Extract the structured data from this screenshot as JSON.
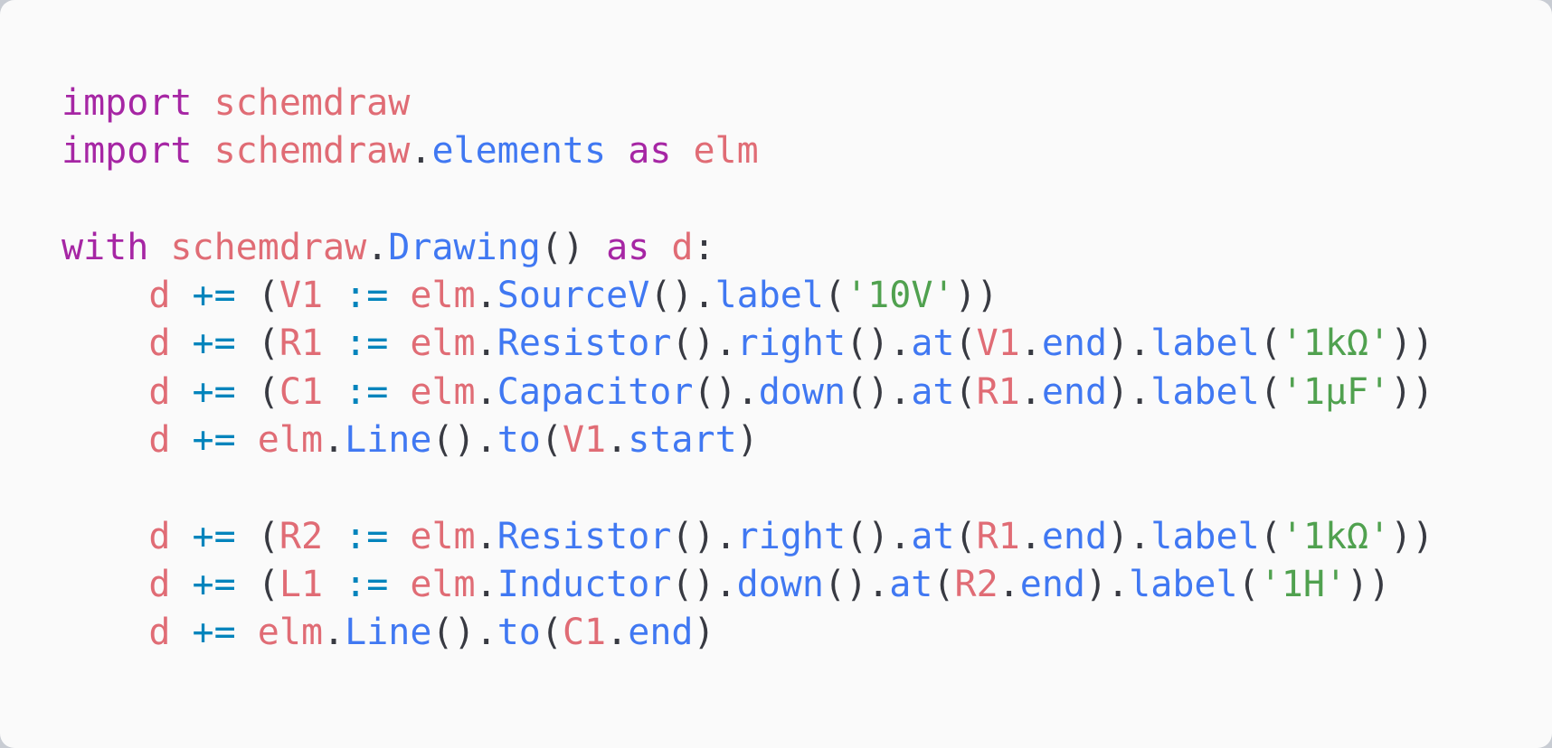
{
  "theme": {
    "background": "#fafafa",
    "text": "#383a42",
    "keyword": "#a626a4",
    "variable": "#e06c75",
    "function": "#4078f2",
    "operator": "#0184bc",
    "string": "#50a14f"
  },
  "code": {
    "language": "python",
    "lines": [
      [
        [
          "kw",
          "import"
        ],
        [
          "pn",
          " "
        ],
        [
          "var",
          "schemdraw"
        ]
      ],
      [
        [
          "kw",
          "import"
        ],
        [
          "pn",
          " "
        ],
        [
          "var",
          "schemdraw"
        ],
        [
          "pn",
          "."
        ],
        [
          "fn",
          "elements"
        ],
        [
          "pn",
          " "
        ],
        [
          "kw",
          "as"
        ],
        [
          "pn",
          " "
        ],
        [
          "var",
          "elm"
        ]
      ],
      [],
      [
        [
          "kw",
          "with"
        ],
        [
          "pn",
          " "
        ],
        [
          "var",
          "schemdraw"
        ],
        [
          "pn",
          "."
        ],
        [
          "fn",
          "Drawing"
        ],
        [
          "pn",
          "() "
        ],
        [
          "kw",
          "as"
        ],
        [
          "pn",
          " "
        ],
        [
          "var",
          "d"
        ],
        [
          "pn",
          ":"
        ]
      ],
      [
        [
          "pn",
          "    "
        ],
        [
          "var",
          "d"
        ],
        [
          "pn",
          " "
        ],
        [
          "op",
          "+="
        ],
        [
          "pn",
          " ("
        ],
        [
          "var",
          "V1"
        ],
        [
          "pn",
          " "
        ],
        [
          "op",
          ":="
        ],
        [
          "pn",
          " "
        ],
        [
          "var",
          "elm"
        ],
        [
          "pn",
          "."
        ],
        [
          "fn",
          "SourceV"
        ],
        [
          "pn",
          "()."
        ],
        [
          "fn",
          "label"
        ],
        [
          "pn",
          "("
        ],
        [
          "str",
          "'10V'"
        ],
        [
          "pn",
          "))"
        ]
      ],
      [
        [
          "pn",
          "    "
        ],
        [
          "var",
          "d"
        ],
        [
          "pn",
          " "
        ],
        [
          "op",
          "+="
        ],
        [
          "pn",
          " ("
        ],
        [
          "var",
          "R1"
        ],
        [
          "pn",
          " "
        ],
        [
          "op",
          ":="
        ],
        [
          "pn",
          " "
        ],
        [
          "var",
          "elm"
        ],
        [
          "pn",
          "."
        ],
        [
          "fn",
          "Resistor"
        ],
        [
          "pn",
          "()."
        ],
        [
          "fn",
          "right"
        ],
        [
          "pn",
          "()."
        ],
        [
          "fn",
          "at"
        ],
        [
          "pn",
          "("
        ],
        [
          "var",
          "V1"
        ],
        [
          "pn",
          "."
        ],
        [
          "fn",
          "end"
        ],
        [
          "pn",
          ")."
        ],
        [
          "fn",
          "label"
        ],
        [
          "pn",
          "("
        ],
        [
          "str",
          "'1kΩ'"
        ],
        [
          "pn",
          "))"
        ]
      ],
      [
        [
          "pn",
          "    "
        ],
        [
          "var",
          "d"
        ],
        [
          "pn",
          " "
        ],
        [
          "op",
          "+="
        ],
        [
          "pn",
          " ("
        ],
        [
          "var",
          "C1"
        ],
        [
          "pn",
          " "
        ],
        [
          "op",
          ":="
        ],
        [
          "pn",
          " "
        ],
        [
          "var",
          "elm"
        ],
        [
          "pn",
          "."
        ],
        [
          "fn",
          "Capacitor"
        ],
        [
          "pn",
          "()."
        ],
        [
          "fn",
          "down"
        ],
        [
          "pn",
          "()."
        ],
        [
          "fn",
          "at"
        ],
        [
          "pn",
          "("
        ],
        [
          "var",
          "R1"
        ],
        [
          "pn",
          "."
        ],
        [
          "fn",
          "end"
        ],
        [
          "pn",
          ")."
        ],
        [
          "fn",
          "label"
        ],
        [
          "pn",
          "("
        ],
        [
          "str",
          "'1μF'"
        ],
        [
          "pn",
          "))"
        ]
      ],
      [
        [
          "pn",
          "    "
        ],
        [
          "var",
          "d"
        ],
        [
          "pn",
          " "
        ],
        [
          "op",
          "+="
        ],
        [
          "pn",
          " "
        ],
        [
          "var",
          "elm"
        ],
        [
          "pn",
          "."
        ],
        [
          "fn",
          "Line"
        ],
        [
          "pn",
          "()."
        ],
        [
          "fn",
          "to"
        ],
        [
          "pn",
          "("
        ],
        [
          "var",
          "V1"
        ],
        [
          "pn",
          "."
        ],
        [
          "fn",
          "start"
        ],
        [
          "pn",
          ")"
        ]
      ],
      [],
      [
        [
          "pn",
          "    "
        ],
        [
          "var",
          "d"
        ],
        [
          "pn",
          " "
        ],
        [
          "op",
          "+="
        ],
        [
          "pn",
          " ("
        ],
        [
          "var",
          "R2"
        ],
        [
          "pn",
          " "
        ],
        [
          "op",
          ":="
        ],
        [
          "pn",
          " "
        ],
        [
          "var",
          "elm"
        ],
        [
          "pn",
          "."
        ],
        [
          "fn",
          "Resistor"
        ],
        [
          "pn",
          "()."
        ],
        [
          "fn",
          "right"
        ],
        [
          "pn",
          "()."
        ],
        [
          "fn",
          "at"
        ],
        [
          "pn",
          "("
        ],
        [
          "var",
          "R1"
        ],
        [
          "pn",
          "."
        ],
        [
          "fn",
          "end"
        ],
        [
          "pn",
          ")."
        ],
        [
          "fn",
          "label"
        ],
        [
          "pn",
          "("
        ],
        [
          "str",
          "'1kΩ'"
        ],
        [
          "pn",
          "))"
        ]
      ],
      [
        [
          "pn",
          "    "
        ],
        [
          "var",
          "d"
        ],
        [
          "pn",
          " "
        ],
        [
          "op",
          "+="
        ],
        [
          "pn",
          " ("
        ],
        [
          "var",
          "L1"
        ],
        [
          "pn",
          " "
        ],
        [
          "op",
          ":="
        ],
        [
          "pn",
          " "
        ],
        [
          "var",
          "elm"
        ],
        [
          "pn",
          "."
        ],
        [
          "fn",
          "Inductor"
        ],
        [
          "pn",
          "()."
        ],
        [
          "fn",
          "down"
        ],
        [
          "pn",
          "()."
        ],
        [
          "fn",
          "at"
        ],
        [
          "pn",
          "("
        ],
        [
          "var",
          "R2"
        ],
        [
          "pn",
          "."
        ],
        [
          "fn",
          "end"
        ],
        [
          "pn",
          ")."
        ],
        [
          "fn",
          "label"
        ],
        [
          "pn",
          "("
        ],
        [
          "str",
          "'1H'"
        ],
        [
          "pn",
          "))"
        ]
      ],
      [
        [
          "pn",
          "    "
        ],
        [
          "var",
          "d"
        ],
        [
          "pn",
          " "
        ],
        [
          "op",
          "+="
        ],
        [
          "pn",
          " "
        ],
        [
          "var",
          "elm"
        ],
        [
          "pn",
          "."
        ],
        [
          "fn",
          "Line"
        ],
        [
          "pn",
          "()."
        ],
        [
          "fn",
          "to"
        ],
        [
          "pn",
          "("
        ],
        [
          "var",
          "C1"
        ],
        [
          "pn",
          "."
        ],
        [
          "fn",
          "end"
        ],
        [
          "pn",
          ")"
        ]
      ]
    ]
  }
}
